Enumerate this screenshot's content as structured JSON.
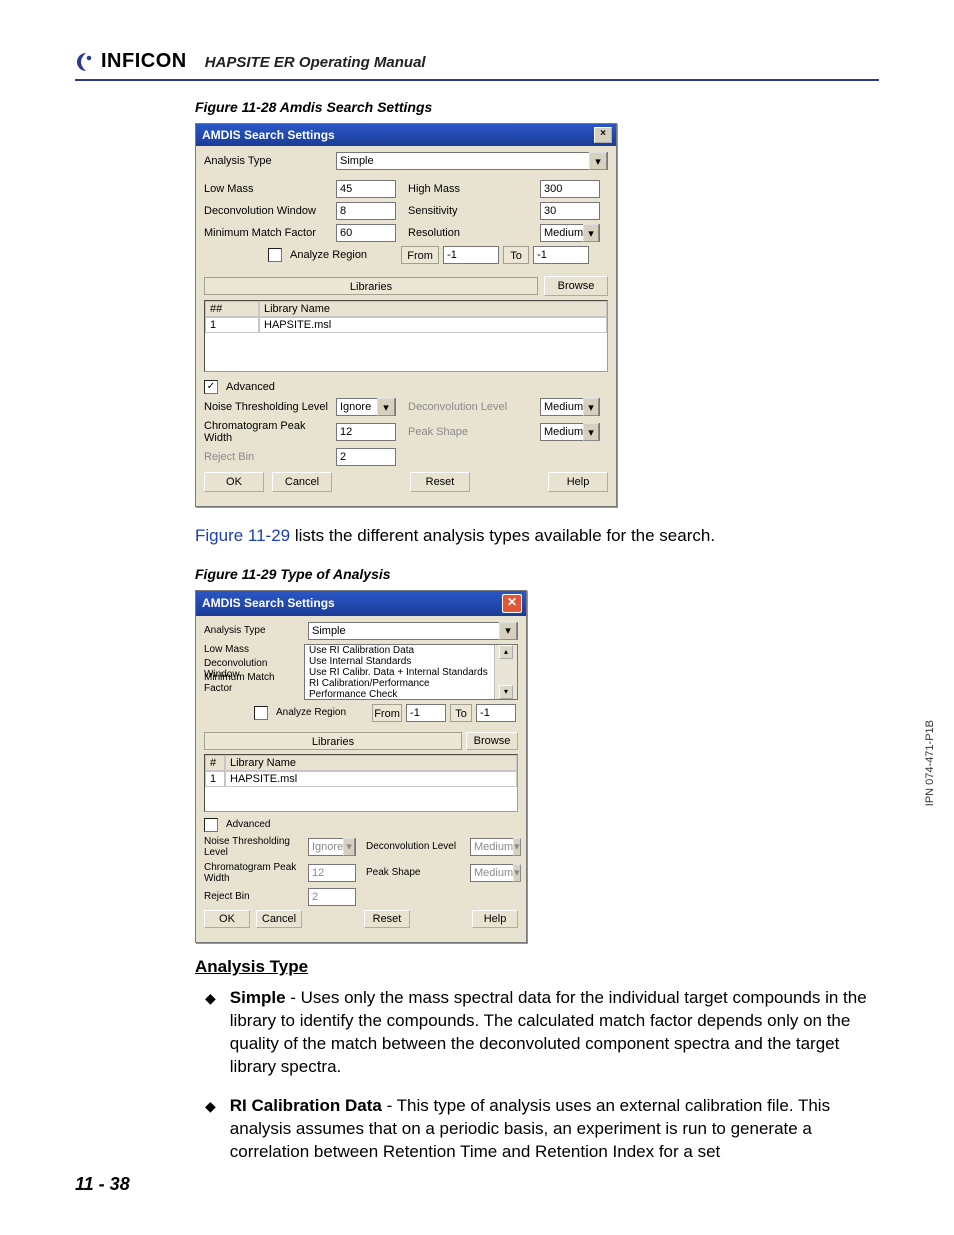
{
  "header": {
    "brand": "INFICON",
    "manual_title": "HAPSITE ER Operating Manual"
  },
  "figure1": {
    "caption": "Figure 11-28  Amdis Search Settings"
  },
  "dialog1": {
    "title": "AMDIS Search Settings",
    "analysis_type_label": "Analysis Type",
    "analysis_type_value": "Simple",
    "low_mass_label": "Low Mass",
    "low_mass_value": "45",
    "high_mass_label": "High Mass",
    "high_mass_value": "300",
    "deconv_label": "Deconvolution Window",
    "deconv_value": "8",
    "sensitivity_label": "Sensitivity",
    "sensitivity_value": "30",
    "minmatch_label": "Minimum Match Factor",
    "minmatch_value": "60",
    "resolution_label": "Resolution",
    "resolution_value": "Medium",
    "analyze_region_label": "Analyze Region",
    "from_label": "From",
    "from_value": "-1",
    "to_label": "To",
    "to_value": "-1",
    "libraries_label": "Libraries",
    "browse_label": "Browse",
    "col_index": "##",
    "col_name": "Library Name",
    "row1_idx": "1",
    "row1_name": "HAPSITE.msl",
    "advanced_label": "Advanced",
    "noise_label": "Noise Thresholding Level",
    "noise_value": "Ignore",
    "deconv_level_label": "Deconvolution Level",
    "deconv_level_value": "Medium",
    "chrom_label": "Chromatogram Peak Width",
    "chrom_value": "12",
    "peak_shape_label": "Peak Shape",
    "peak_shape_value": "Medium",
    "reject_label": "Reject Bin",
    "reject_value": "2",
    "ok": "OK",
    "cancel": "Cancel",
    "reset": "Reset",
    "help": "Help"
  },
  "midtext": {
    "figref": "Figure 11-29",
    "rest": " lists the different analysis types available for the search."
  },
  "figure2": {
    "caption": "Figure 11-29  Type of Analysis"
  },
  "dialog2": {
    "title": "AMDIS Search Settings",
    "analysis_type_label": "Analysis Type",
    "analysis_type_value": "Simple",
    "options": [
      "Use RI Calibration Data",
      "Use Internal Standards",
      "Use RI Calibr. Data + Internal Standards",
      "RI Calibration/Performance",
      "Performance Check"
    ],
    "low_mass_label": "Low Mass",
    "deconv_label": "Deconvolution Window",
    "minmatch_label": "Minimum Match Factor",
    "analyze_region_label": "Analyze Region",
    "from_label": "From",
    "from_value": "-1",
    "to_label": "To",
    "to_value": "-1",
    "libraries_label": "Libraries",
    "browse_label": "Browse",
    "col_index": "#",
    "col_name": "Library Name",
    "row1_idx": "1",
    "row1_name": "HAPSITE.msl",
    "advanced_label": "Advanced",
    "noise_label": "Noise Thresholding Level",
    "noise_value": "Ignore",
    "deconv_level_label": "Deconvolution Level",
    "deconv_level_value": "Medium",
    "chrom_label": "Chromatogram Peak Width",
    "chrom_value": "12",
    "peak_shape_label": "Peak Shape",
    "peak_shape_value": "Medium",
    "reject_label": "Reject Bin",
    "reject_value": "2",
    "ok": "OK",
    "cancel": "Cancel",
    "reset": "Reset",
    "help": "Help"
  },
  "analysis_heading": "Analysis Type",
  "bullets": [
    {
      "term": "Simple",
      "text": " - Uses only the mass spectral data for the individual target compounds in the library to identify the compounds. The calculated match factor depends only on the quality of the match between the deconvoluted component spectra and the target library spectra."
    },
    {
      "term": "RI Calibration Data",
      "text": " - This type of analysis uses an external calibration file. This analysis assumes that on a periodic basis, an experiment is run to generate a correlation between Retention Time and Retention Index for a set"
    }
  ],
  "footer": {
    "page": "11 - 38",
    "ipn": "IPN 074-471-P1B"
  }
}
